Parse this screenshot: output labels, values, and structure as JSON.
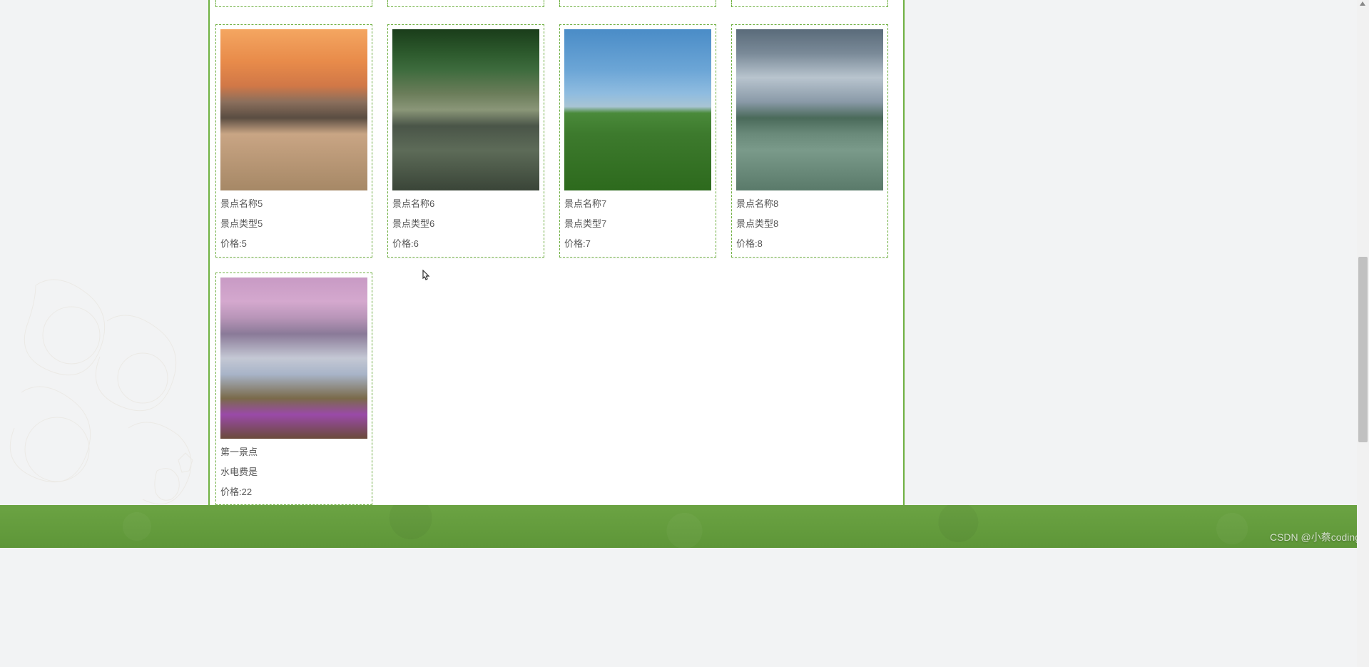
{
  "labels": {
    "price_prefix": "价格:"
  },
  "cards": [
    {
      "name": "景点名称5",
      "type": "景点类型5",
      "price": "5",
      "image_class": "img-5"
    },
    {
      "name": "景点名称6",
      "type": "景点类型6",
      "price": "6",
      "image_class": "img-6"
    },
    {
      "name": "景点名称7",
      "type": "景点类型7",
      "price": "7",
      "image_class": "img-7"
    },
    {
      "name": "景点名称8",
      "type": "景点类型8",
      "price": "8",
      "image_class": "img-8"
    },
    {
      "name": "第一景点",
      "type": "水电费是",
      "price": "22",
      "image_class": "img-9"
    }
  ],
  "watermark": "CSDN @小蔡coding"
}
